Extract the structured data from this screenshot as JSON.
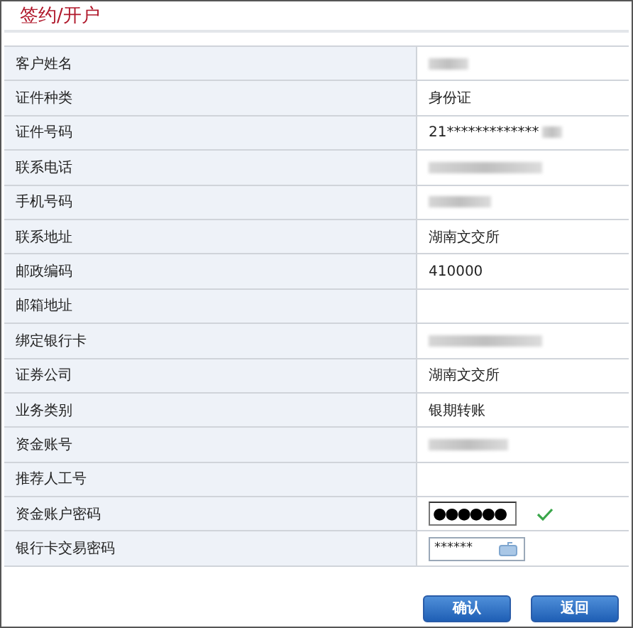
{
  "title": "签约/开户",
  "rows": [
    {
      "label": "客户姓名",
      "kind": "blurred"
    },
    {
      "label": "证件种类",
      "kind": "text",
      "value": "身份证"
    },
    {
      "label": "证件号码",
      "kind": "partial",
      "value": "21*************"
    },
    {
      "label": "联系电话",
      "kind": "blurred"
    },
    {
      "label": "手机号码",
      "kind": "blurred"
    },
    {
      "label": "联系地址",
      "kind": "text",
      "value": "湖南文交所"
    },
    {
      "label": "邮政编码",
      "kind": "text",
      "value": "410000"
    },
    {
      "label": "邮箱地址",
      "kind": "empty"
    },
    {
      "label": "绑定银行卡",
      "kind": "blurred"
    },
    {
      "label": "证券公司",
      "kind": "text",
      "value": "湖南文交所"
    },
    {
      "label": "业务类别",
      "kind": "text",
      "value": "银期转账"
    },
    {
      "label": "资金账号",
      "kind": "blurred"
    },
    {
      "label": "推荐人工号",
      "kind": "empty"
    },
    {
      "label": "资金账户密码",
      "kind": "password",
      "value": "●●●●●●",
      "valid": true
    },
    {
      "label": "银行卡交易密码",
      "kind": "keypad",
      "value": "******"
    }
  ],
  "buttons": [
    "确认",
    "返回"
  ]
}
